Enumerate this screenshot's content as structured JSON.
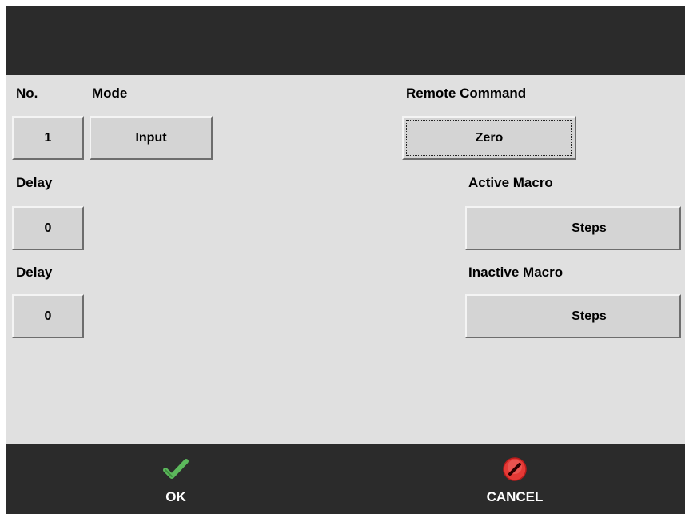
{
  "labels": {
    "no": "No.",
    "mode": "Mode",
    "remote_command": "Remote Command",
    "delay_1": "Delay",
    "active_macro": "Active Macro",
    "delay_2": "Delay",
    "inactive_macro": "Inactive Macro"
  },
  "fields": {
    "number": "1",
    "mode": "Input",
    "remote_command": "Zero",
    "delay_1": "0",
    "active_macro": "Steps",
    "delay_2": "0",
    "inactive_macro": "Steps"
  },
  "footer": {
    "ok_label": "OK",
    "cancel_label": "CANCEL",
    "ok_icon": "checkmark-icon",
    "cancel_icon": "cancel-icon"
  },
  "colors": {
    "titlebar": "#2b2b2b",
    "panel": "#e0e0e0",
    "ok_green": "#5cb85c",
    "cancel_red": "#e53935"
  }
}
